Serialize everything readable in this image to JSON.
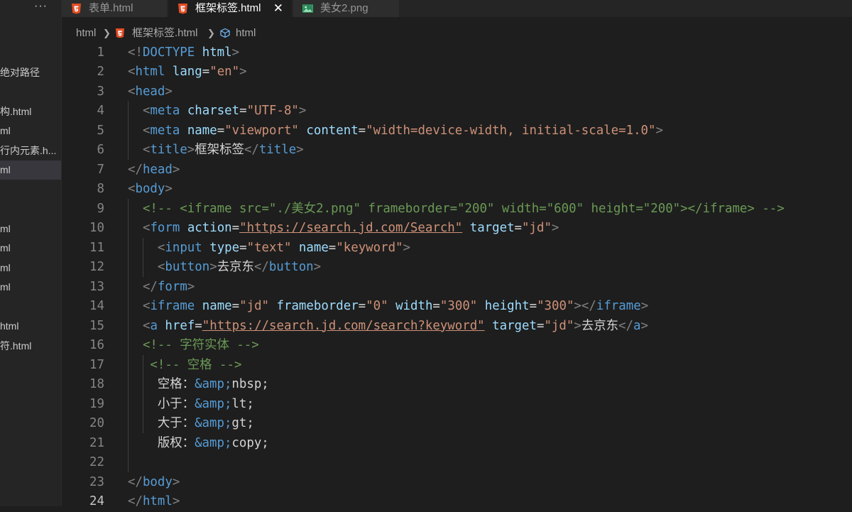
{
  "sidebar": {
    "more_label": "···",
    "items": [
      {
        "label": "绝对路径"
      },
      {
        "label": "构.html"
      },
      {
        "label": "ml"
      },
      {
        "label": "行内元素.h..."
      },
      {
        "label": "ml",
        "active": true
      },
      {
        "label": "ml"
      },
      {
        "label": "ml"
      },
      {
        "label": "ml"
      },
      {
        "label": "ml"
      },
      {
        "label": "html"
      },
      {
        "label": "符.html"
      }
    ]
  },
  "tabs": [
    {
      "label": "表单.html",
      "icon": "html5-icon",
      "active": false
    },
    {
      "label": "框架标签.html",
      "icon": "html5-icon",
      "active": true,
      "close": "✕"
    },
    {
      "label": "美女2.png",
      "icon": "image-icon",
      "active": false
    }
  ],
  "breadcrumb": {
    "folder": "html",
    "file": "框架标签.html",
    "symbol": "html"
  },
  "editor": {
    "current_line": 24,
    "lines": [
      {
        "n": "1",
        "text": "<!DOCTYPE html>"
      },
      {
        "n": "2",
        "text": "<html lang=\"en\">"
      },
      {
        "n": "3",
        "text": "<head>"
      },
      {
        "n": "4",
        "text": "  <meta charset=\"UTF-8\">"
      },
      {
        "n": "5",
        "text": "  <meta name=\"viewport\" content=\"width=device-width, initial-scale=1.0\">"
      },
      {
        "n": "6",
        "text": "  <title>框架标签</title>"
      },
      {
        "n": "7",
        "text": "</head>"
      },
      {
        "n": "8",
        "text": "<body>"
      },
      {
        "n": "9",
        "text": "  <!-- <iframe src=\"./美女2.png\" frameborder=\"200\" width=\"600\" height=\"200\"></iframe> -->"
      },
      {
        "n": "10",
        "text": "  <form action=\"https://search.jd.com/Search\" target=\"jd\">"
      },
      {
        "n": "11",
        "text": "    <input type=\"text\" name=\"keyword\">"
      },
      {
        "n": "12",
        "text": "    <button>去京东</button>"
      },
      {
        "n": "13",
        "text": "  </form>"
      },
      {
        "n": "14",
        "text": "  <iframe name=\"jd\" frameborder=\"0\" width=\"300\" height=\"300\"></iframe>"
      },
      {
        "n": "15",
        "text": "  <a href=\"https://search.jd.com/search?keyword\" target=\"jd\">去京东</a>"
      },
      {
        "n": "16",
        "text": "  <!-- 字符实体 -->"
      },
      {
        "n": "17",
        "text": "   <!-- 空格 -->"
      },
      {
        "n": "18",
        "text": "    空格：&amp;nbsp;"
      },
      {
        "n": "19",
        "text": "    小于：&amp;lt;"
      },
      {
        "n": "20",
        "text": "    大于：&amp;gt;"
      },
      {
        "n": "21",
        "text": "    版权：&amp;copy;"
      },
      {
        "n": "22",
        "text": ""
      },
      {
        "n": "23",
        "text": "</body>"
      },
      {
        "n": "24",
        "text": "</html>"
      }
    ]
  }
}
